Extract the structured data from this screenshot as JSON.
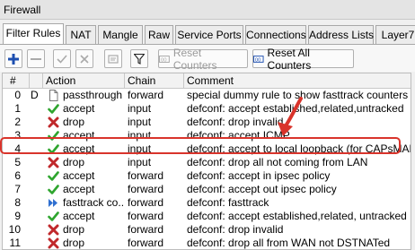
{
  "window": {
    "title": "Firewall"
  },
  "tabs": [
    "Filter Rules",
    "NAT",
    "Mangle",
    "Raw",
    "Service Ports",
    "Connections",
    "Address Lists",
    "Layer7"
  ],
  "toolbar": {
    "reset_counters": "Reset Counters",
    "reset_all_counters": "Reset All Counters"
  },
  "table": {
    "columns": [
      "#",
      "",
      "Action",
      "Chain",
      "Comment"
    ],
    "rows": [
      {
        "num": "0",
        "flag": "D",
        "action": "passthrough",
        "action_icon": "passthrough-icon",
        "chain": "forward",
        "comment": "special dummy rule to show fasttrack counters"
      },
      {
        "num": "1",
        "flag": "",
        "action": "accept",
        "action_icon": "check-icon",
        "chain": "input",
        "comment": "defconf: accept established,related,untracked"
      },
      {
        "num": "2",
        "flag": "",
        "action": "drop",
        "action_icon": "cross-icon",
        "chain": "input",
        "comment": "defconf: drop invalid"
      },
      {
        "num": "3",
        "flag": "",
        "action": "accept",
        "action_icon": "check-icon",
        "chain": "input",
        "comment": "defconf: accept ICMP"
      },
      {
        "num": "4",
        "flag": "",
        "action": "accept",
        "action_icon": "check-icon",
        "chain": "input",
        "comment": "defconf: accept to local loopback (for CAPsMAN)"
      },
      {
        "num": "5",
        "flag": "",
        "action": "drop",
        "action_icon": "cross-icon",
        "chain": "input",
        "comment": "defconf: drop all not coming from LAN"
      },
      {
        "num": "6",
        "flag": "",
        "action": "accept",
        "action_icon": "check-icon",
        "chain": "forward",
        "comment": "defconf: accept in ipsec policy"
      },
      {
        "num": "7",
        "flag": "",
        "action": "accept",
        "action_icon": "check-icon",
        "chain": "forward",
        "comment": "defconf: accept out ipsec policy"
      },
      {
        "num": "8",
        "flag": "",
        "action": "fasttrack co...",
        "action_icon": "fasttrack-icon",
        "chain": "forward",
        "comment": "defconf: fasttrack"
      },
      {
        "num": "9",
        "flag": "",
        "action": "accept",
        "action_icon": "check-icon",
        "chain": "forward",
        "comment": "defconf: accept established,related, untracked"
      },
      {
        "num": "10",
        "flag": "",
        "action": "drop",
        "action_icon": "cross-icon",
        "chain": "forward",
        "comment": "defconf: drop invalid"
      },
      {
        "num": "11",
        "flag": "",
        "action": "drop",
        "action_icon": "cross-icon",
        "chain": "forward",
        "comment": "defconf: drop all from WAN not DSTNATed"
      }
    ]
  },
  "colors": {
    "highlight": "#d9342b",
    "accept": "#2ea52e",
    "drop": "#c0282b",
    "fasttrack": "#2f6fd0"
  }
}
